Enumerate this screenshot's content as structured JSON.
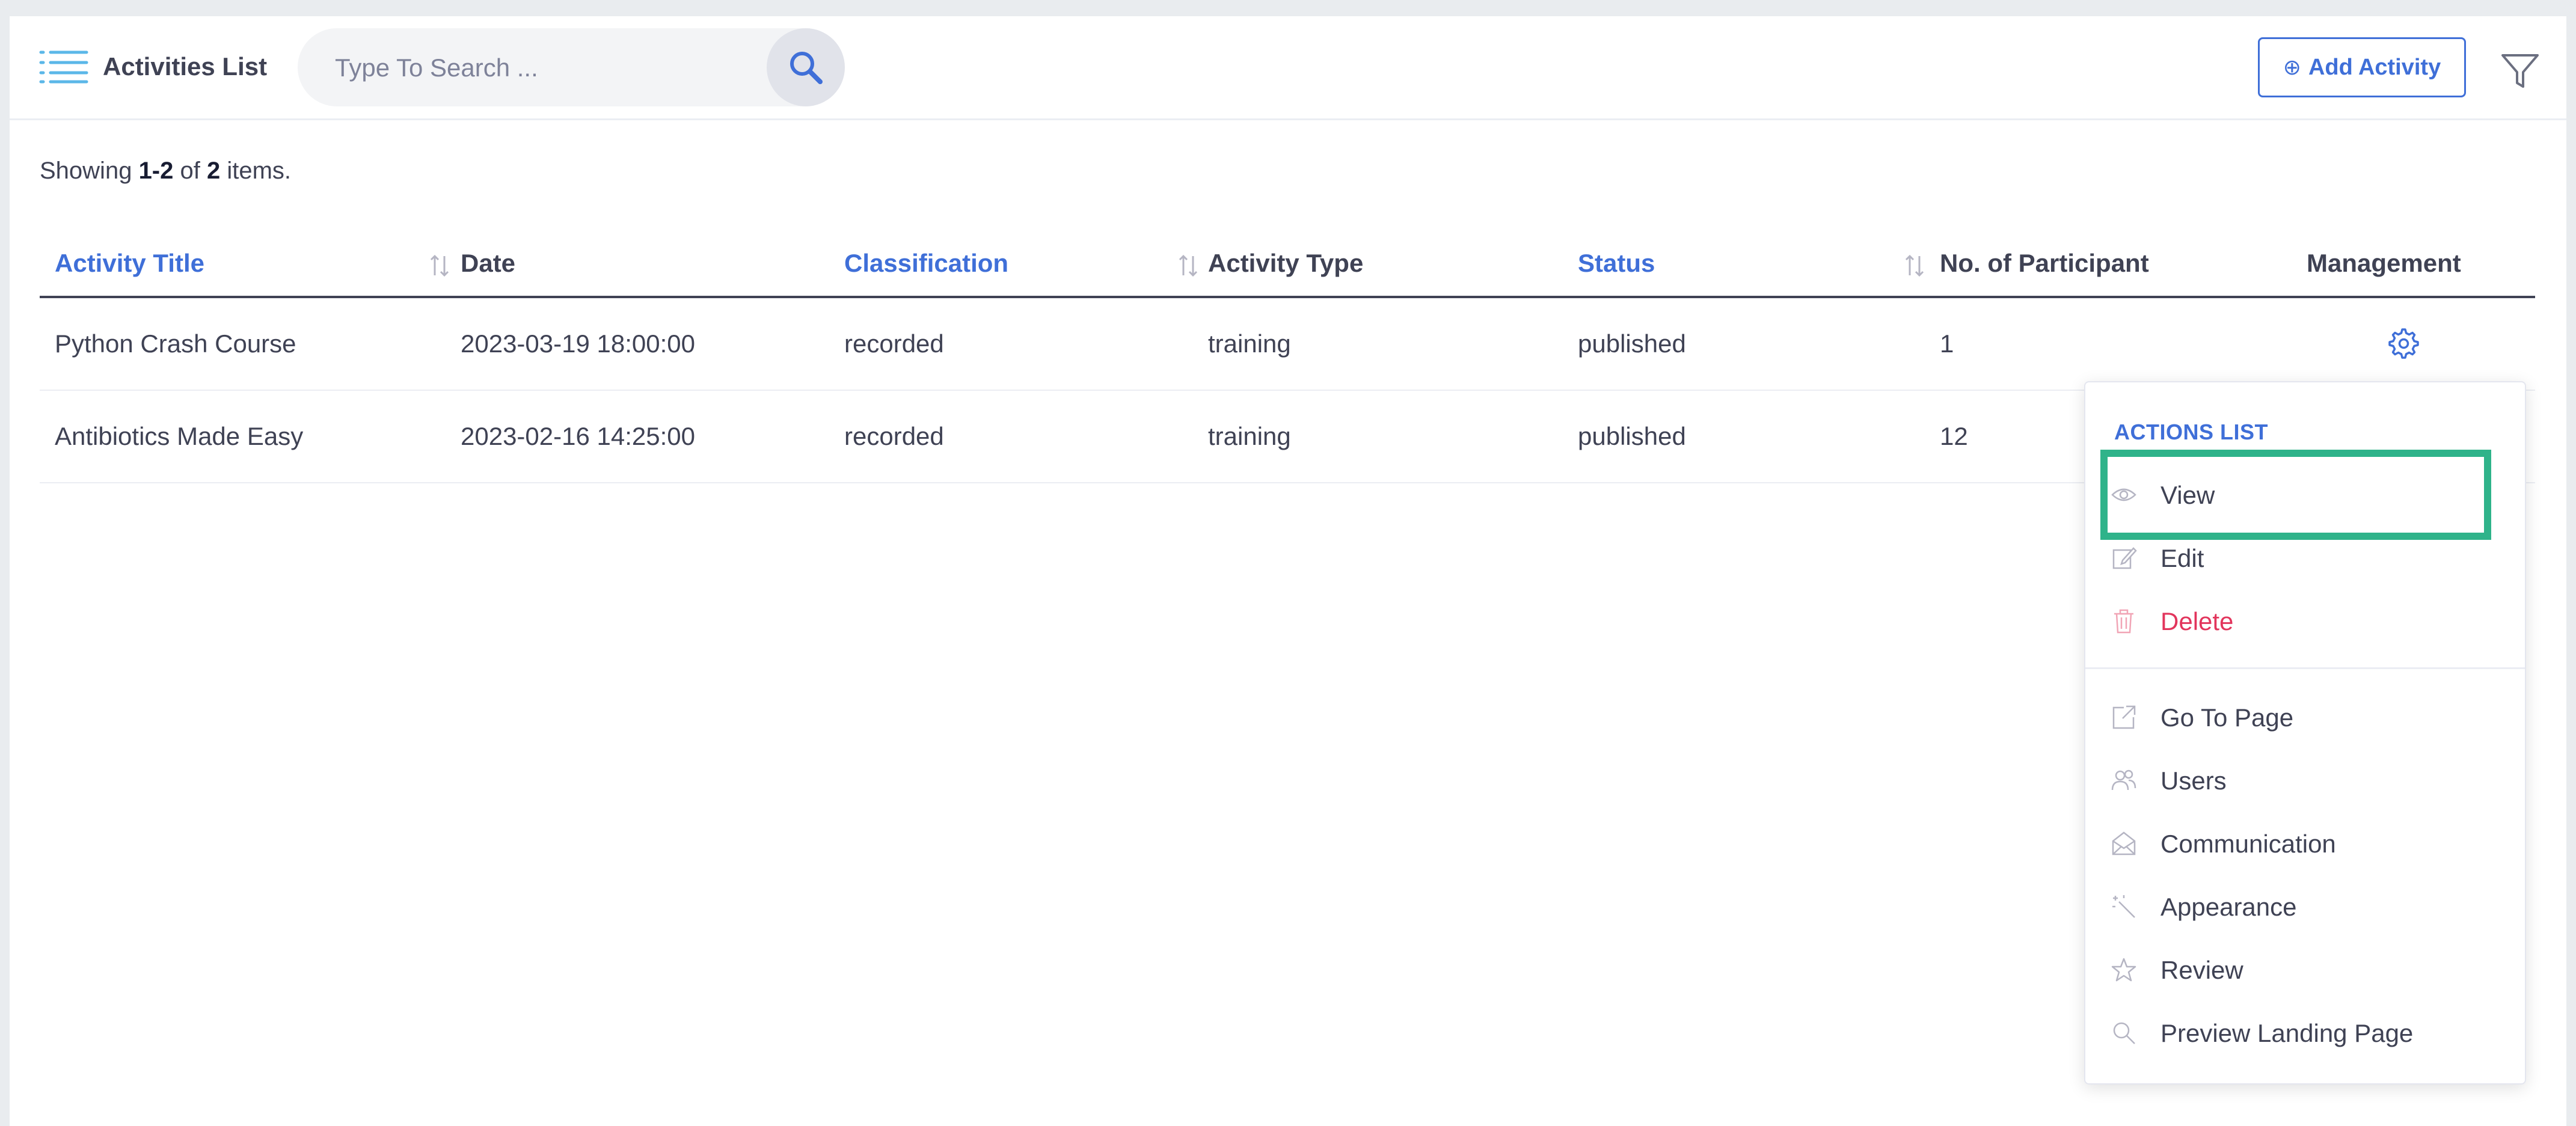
{
  "header": {
    "title": "Activities List",
    "search_placeholder": "Type To Search ...",
    "add_button_label": "Add Activity",
    "add_button_icon": "⊕"
  },
  "summary": {
    "prefix": "Showing ",
    "range": "1-2",
    "middle": " of ",
    "total": "2",
    "suffix": " items."
  },
  "table": {
    "columns": [
      {
        "label": "Activity Title",
        "sortable": true
      },
      {
        "label": "Date",
        "sortable": false
      },
      {
        "label": "Classification",
        "sortable": true
      },
      {
        "label": "Activity Type",
        "sortable": false
      },
      {
        "label": "Status",
        "sortable": true
      },
      {
        "label": "No. of Participant",
        "sortable": false
      },
      {
        "label": "Management",
        "sortable": false
      }
    ],
    "rows": [
      {
        "title": "Python Crash Course",
        "date": "2023-03-19 18:00:00",
        "classification": "recorded",
        "type": "training",
        "status": "published",
        "participants": "1"
      },
      {
        "title": "Antibiotics Made Easy",
        "date": "2023-02-16 14:25:00",
        "classification": "recorded",
        "type": "training",
        "status": "published",
        "participants": "12"
      }
    ]
  },
  "actions_menu": {
    "heading": "ACTIONS LIST",
    "items": [
      {
        "label": "View",
        "icon": "eye-icon"
      },
      {
        "label": "Edit",
        "icon": "edit-icon"
      },
      {
        "label": "Delete",
        "icon": "trash-icon"
      },
      {
        "label": "Go To Page",
        "icon": "external-page-icon"
      },
      {
        "label": "Users",
        "icon": "users-icon"
      },
      {
        "label": "Communication",
        "icon": "mail-icon"
      },
      {
        "label": "Appearance",
        "icon": "magic-wand-icon"
      },
      {
        "label": "Review",
        "icon": "star-icon"
      },
      {
        "label": "Preview Landing Page",
        "icon": "magnifier-icon"
      }
    ]
  },
  "colors": {
    "accent": "#3f6fd8",
    "danger": "#e2355c",
    "highlight": "#2fb38a",
    "text": "#3f4254"
  }
}
